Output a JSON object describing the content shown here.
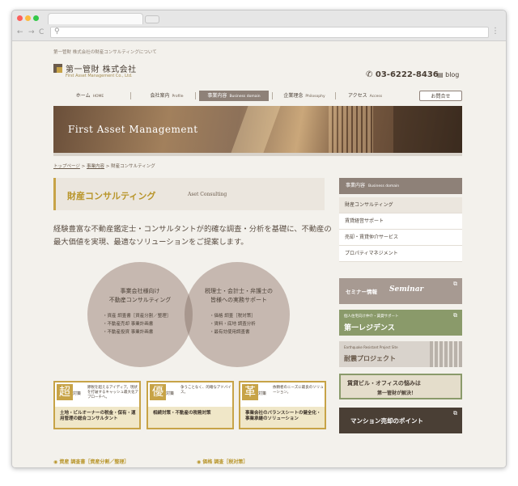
{
  "header": {
    "tagline": "第一管財 株式会社の財産コンサルティングについて",
    "company_name": "第一管財 株式会社",
    "company_en": "First Asset Management Co., Ltd.",
    "phone": "03-6222-8436",
    "blog": "blog"
  },
  "nav": {
    "items": [
      {
        "label": "ホーム",
        "sub": "HOME"
      },
      {
        "label": "会社案内",
        "sub": "Profile"
      },
      {
        "label": "事業内容",
        "sub": "Business domain"
      },
      {
        "label": "企業理念",
        "sub": "Philosophy"
      },
      {
        "label": "アクセス",
        "sub": "Access"
      }
    ],
    "contact": "お問合せ"
  },
  "hero": {
    "title": "First Asset Management"
  },
  "breadcrumb": {
    "home": "トップページ",
    "sep": ">",
    "parent": "事業内容",
    "current": "財産コンサルティング"
  },
  "main": {
    "title": "財産コンサルティング",
    "title_en": "Aset Consulting",
    "intro": "経験豊富な不動産鑑定士・コンサルタントが的確な調査・分析を基礎に、不動産の最大価値を実現、最適なソリューションをご提案します。",
    "circles": [
      {
        "title1": "事業会社様向け",
        "title2": "不動産コンサルティング",
        "items": [
          "・資産 調査書［資産分割／整理］",
          "・不動産売却 事業計画書",
          "・不動産投資 事業計画書"
        ]
      },
      {
        "title1": "税理士・会計士・弁護士の",
        "title2": "皆様への実務サポート",
        "items": [
          "・価格 調査［税対策］",
          "・賃料・底地 調査分析",
          "・最有効使用調査書"
        ]
      }
    ],
    "features": [
      {
        "char": "超",
        "tag": "対策",
        "desc": "節税を超えるアイディア。現状を打破するキャッシュ最大化アプローチへ。",
        "bottom": "土地・ビルオーナーの税金・保有・運用管理の総合コンサルタント"
      },
      {
        "char": "優",
        "tag": "対策",
        "desc": "争うことなく、的確なアドバイス。",
        "bottom": "相続対策・不動産の税務対策"
      },
      {
        "char": "革",
        "tag": "対策",
        "desc": "依頼者のニーズに最良のソリューション。",
        "bottom": "事業会社のバランスシートの健全化・事業承継のソリューション"
      }
    ],
    "bottom_links": [
      "資産 調査書［資産分割／整理］",
      "価格 調査［税対策］"
    ]
  },
  "sidebar": {
    "head": "事業内容",
    "head_sub": "Business domain",
    "items": [
      "財産コンサルティング",
      "賃貸経営サポート",
      "売却・賃貸仲介サービス",
      "プロパティマネジメント"
    ],
    "banners": {
      "seminar": "セミナー情報",
      "seminar_en": "Seminar",
      "residence_small": "個人住宅向け仲介・賃貸サポート",
      "residence": "第一レジデンス",
      "earthquake_small": "Earthquake Resistant Project Site",
      "earthquake": "耐震プロジェクト",
      "building": "賃貸ビル・オフィスの悩みは",
      "building2": "第一管財が解決！",
      "mansion": "マンション売却のポイント"
    }
  }
}
